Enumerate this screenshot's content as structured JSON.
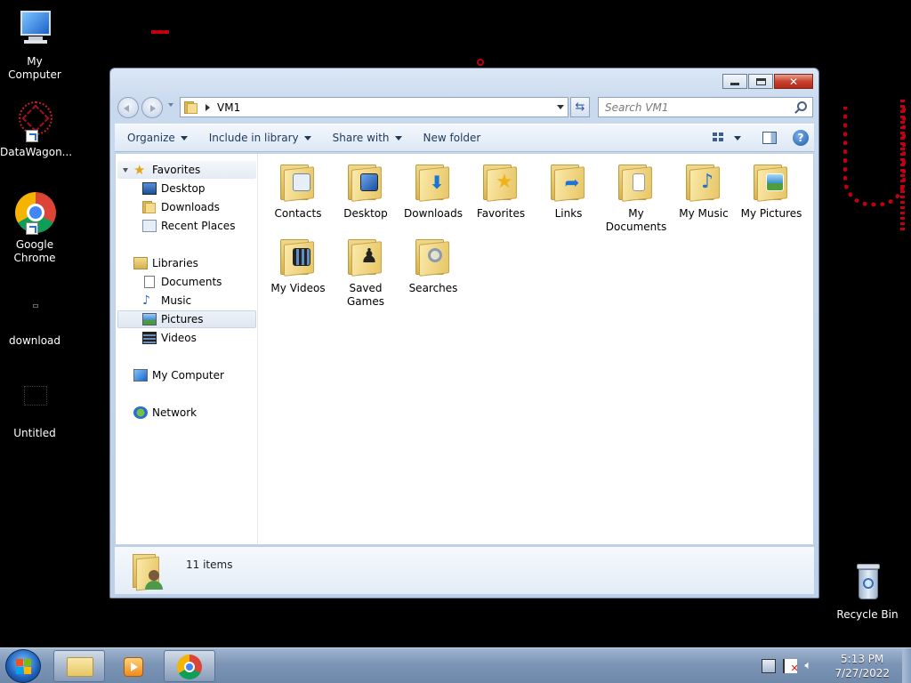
{
  "desktop": {
    "icons": [
      {
        "label": "My Computer",
        "icon": "computer-icon"
      },
      {
        "label": "DataWagon...",
        "icon": "datawagon-icon"
      },
      {
        "label": "Google Chrome",
        "icon": "chrome-icon"
      },
      {
        "label": "download",
        "icon": "file-icon"
      },
      {
        "label": "Untitled",
        "icon": "image-file-icon"
      },
      {
        "label": "Recycle Bin",
        "icon": "recycle-bin-icon"
      }
    ]
  },
  "window": {
    "address": {
      "path": "VM1"
    },
    "search": {
      "placeholder": "Search VM1"
    },
    "commands": {
      "organize": "Organize",
      "include": "Include in library",
      "share": "Share with",
      "new_folder": "New folder"
    },
    "nav": {
      "favorites": "Favorites",
      "desktop": "Desktop",
      "downloads": "Downloads",
      "recent": "Recent Places",
      "libraries": "Libraries",
      "documents": "Documents",
      "music": "Music",
      "pictures": "Pictures",
      "videos": "Videos",
      "computer": "My Computer",
      "network": "Network",
      "selected": "Pictures"
    },
    "files": [
      {
        "name": "Contacts",
        "emblem": "contacts-icon"
      },
      {
        "name": "Desktop",
        "emblem": "desktop-icon"
      },
      {
        "name": "Downloads",
        "emblem": "download-arrow-icon"
      },
      {
        "name": "Favorites",
        "emblem": "star-icon"
      },
      {
        "name": "Links",
        "emblem": "link-arrow-icon"
      },
      {
        "name": "My Documents",
        "emblem": "document-icon"
      },
      {
        "name": "My Music",
        "emblem": "music-note-icon"
      },
      {
        "name": "My Pictures",
        "emblem": "picture-icon"
      },
      {
        "name": "My Videos",
        "emblem": "film-icon"
      },
      {
        "name": "Saved Games",
        "emblem": "chess-piece-icon"
      },
      {
        "name": "Searches",
        "emblem": "magnifier-icon"
      }
    ],
    "details": {
      "count": "11 items"
    }
  },
  "taskbar": {
    "clock": {
      "time": "5:13 PM",
      "date": "7/27/2022"
    }
  },
  "colors": {
    "accent_red": "#d10010",
    "folder_yellow": "#f0d98a",
    "taskbar_blue": "#7c95b6"
  }
}
